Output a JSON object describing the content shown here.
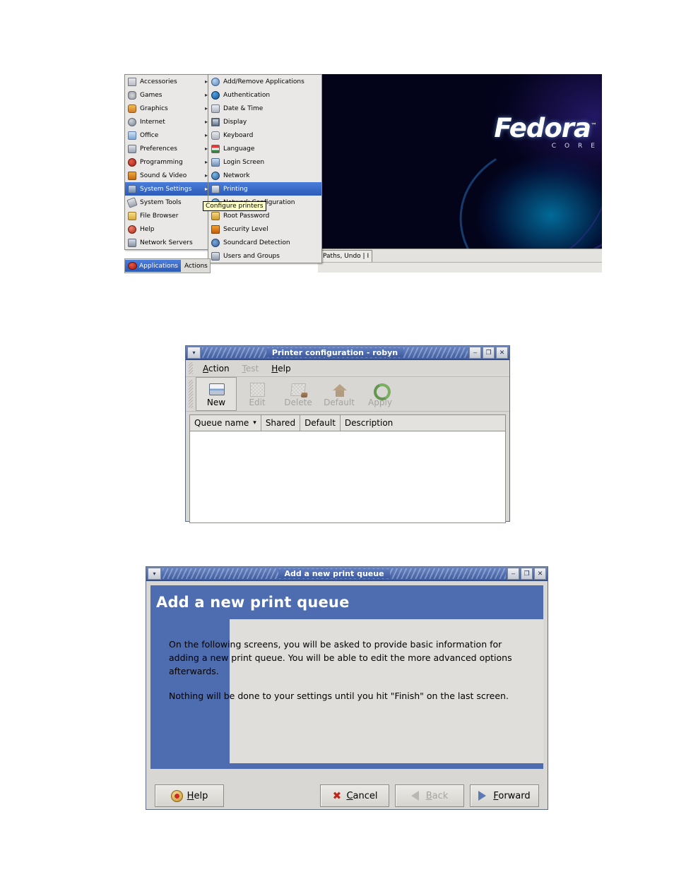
{
  "gnome_menu": {
    "applications_menu": [
      {
        "label": "Accessories",
        "icon": "accessories-icon",
        "submenu": true
      },
      {
        "label": "Games",
        "icon": "games-icon",
        "submenu": true
      },
      {
        "label": "Graphics",
        "icon": "graphics-icon",
        "submenu": true
      },
      {
        "label": "Internet",
        "icon": "internet-icon",
        "submenu": true
      },
      {
        "label": "Office",
        "icon": "office-icon",
        "submenu": true
      },
      {
        "label": "Preferences",
        "icon": "preferences-icon",
        "submenu": true
      },
      {
        "label": "Programming",
        "icon": "programming-icon",
        "submenu": true
      },
      {
        "label": "Sound & Video",
        "icon": "sound-video-icon",
        "submenu": true
      },
      {
        "label": "System Settings",
        "icon": "system-settings-icon",
        "submenu": true,
        "selected": true
      },
      {
        "label": "System Tools",
        "icon": "system-tools-icon",
        "submenu": true
      },
      {
        "label": "File Browser",
        "icon": "file-browser-icon",
        "submenu": false
      },
      {
        "label": "Help",
        "icon": "help-icon",
        "submenu": false
      },
      {
        "label": "Network Servers",
        "icon": "network-servers-icon",
        "submenu": false
      }
    ],
    "system_settings_submenu": [
      {
        "label": "Add/Remove Applications",
        "icon": "add-remove-applications-icon"
      },
      {
        "label": "Authentication",
        "icon": "authentication-icon"
      },
      {
        "label": "Date & Time",
        "icon": "date-time-icon"
      },
      {
        "label": "Display",
        "icon": "display-icon"
      },
      {
        "label": "Keyboard",
        "icon": "keyboard-icon"
      },
      {
        "label": "Language",
        "icon": "language-icon"
      },
      {
        "label": "Login Screen",
        "icon": "login-screen-icon"
      },
      {
        "label": "Network",
        "icon": "network-icon"
      },
      {
        "label": "Printing",
        "icon": "printing-icon",
        "selected": true
      },
      {
        "label": "Network Configuration",
        "icon": "network-configuration-icon"
      },
      {
        "label": "Root Password",
        "icon": "root-password-icon"
      },
      {
        "label": "Security Level",
        "icon": "security-level-icon"
      },
      {
        "label": "Soundcard Detection",
        "icon": "soundcard-detection-icon"
      },
      {
        "label": "Users and Groups",
        "icon": "users-and-groups-icon"
      }
    ],
    "tooltip": "Configure printers",
    "panel": {
      "applications_label": "Applications",
      "actions_label": "Actions"
    },
    "desktop": {
      "wallpaper_brand": "Fedora",
      "wallpaper_trademark": "™",
      "wallpaper_subtitle": "CORE",
      "window_tab_label": "Paths, Undo | I"
    },
    "colors": {
      "menu_selection": "#2c5bb8",
      "tooltip_bg": "#ffffc8",
      "menu_bg": "#e9e8e6"
    }
  },
  "printer_config": {
    "title": "Printer configuration - robyn",
    "titlebar_buttons": {
      "menu": "▾",
      "minimize": "‒",
      "maximize": "❐",
      "close": "✕"
    },
    "menubar": [
      {
        "label": "Action",
        "mnemonic": "A",
        "enabled": true
      },
      {
        "label": "Test",
        "mnemonic": "T",
        "enabled": false
      },
      {
        "label": "Help",
        "mnemonic": "H",
        "enabled": true
      }
    ],
    "toolbar": [
      {
        "label": "New",
        "icon": "new-printer-icon",
        "enabled": true,
        "active": true
      },
      {
        "label": "Edit",
        "icon": "edit-icon",
        "enabled": false
      },
      {
        "label": "Delete",
        "icon": "delete-icon",
        "enabled": false
      },
      {
        "label": "Default",
        "icon": "default-home-icon",
        "enabled": false
      },
      {
        "label": "Apply",
        "icon": "apply-refresh-icon",
        "enabled": false
      }
    ],
    "list": {
      "columns": [
        {
          "label": "Queue name",
          "sort_indicator": "▾"
        },
        {
          "label": "Shared"
        },
        {
          "label": "Default"
        },
        {
          "label": "Description"
        }
      ],
      "rows": []
    }
  },
  "add_queue_dialog": {
    "title": "Add a new print queue",
    "titlebar_buttons": {
      "menu": "▾",
      "minimize": "‒",
      "maximize": "❐",
      "close": "✕"
    },
    "heading": "Add a new print queue",
    "paragraphs": [
      "On the following screens, you will be asked to provide basic information for adding a new print queue.  You will be able to edit the more advanced options afterwards.",
      "Nothing will be done to your settings until you hit \"Finish\" on the last screen."
    ],
    "buttons": [
      {
        "label": "Help",
        "mnemonic": "H",
        "icon": "help-lifebuoy-icon",
        "enabled": true
      },
      {
        "label": "Cancel",
        "mnemonic": "C",
        "icon": "cancel-x-icon",
        "enabled": true
      },
      {
        "label": "Back",
        "mnemonic": "B",
        "icon": "back-arrow-icon",
        "enabled": false
      },
      {
        "label": "Forward",
        "mnemonic": "F",
        "icon": "forward-arrow-icon",
        "enabled": true
      }
    ],
    "colors": {
      "sidebar": "#4e6db0",
      "panel": "#dfdedb",
      "titlebar": "#3d5b9e"
    }
  }
}
